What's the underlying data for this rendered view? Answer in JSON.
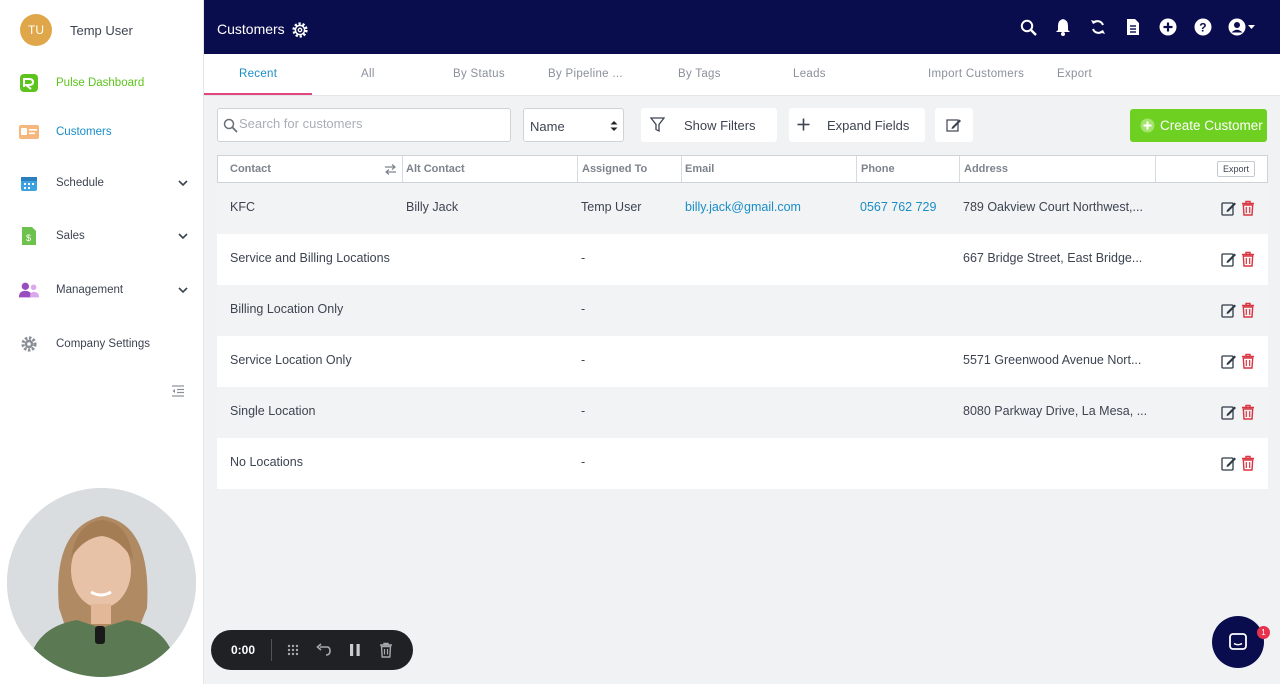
{
  "user": {
    "initials": "TU",
    "name": "Temp User"
  },
  "sidebar": {
    "items": [
      {
        "label": "Pulse Dashboard",
        "color": "#5cc41c"
      },
      {
        "label": "Customers",
        "color": "#1a8dc5"
      },
      {
        "label": "Schedule",
        "color": "#3d4451"
      },
      {
        "label": "Sales",
        "color": "#3d4451"
      },
      {
        "label": "Management",
        "color": "#3d4451"
      },
      {
        "label": "Company Settings",
        "color": "#3d4451"
      }
    ]
  },
  "recorder": {
    "time": "0:00"
  },
  "header": {
    "title": "Customers"
  },
  "tabs": [
    {
      "label": "Recent"
    },
    {
      "label": "All"
    },
    {
      "label": "By Status"
    },
    {
      "label": "By Pipeline ..."
    },
    {
      "label": "By Tags"
    },
    {
      "label": "Leads"
    },
    {
      "label": "Import Customers"
    },
    {
      "label": "Export"
    }
  ],
  "toolbar": {
    "search_placeholder": "Search for customers",
    "sort_value": "Name",
    "show_filters": "Show Filters",
    "expand_fields": "Expand Fields",
    "create_customer": "Create Customer"
  },
  "table": {
    "columns": [
      "Contact",
      "Alt Contact",
      "Assigned To",
      "Email",
      "Phone",
      "Address"
    ],
    "export_label": "Export",
    "rows": [
      {
        "contact": "KFC",
        "alt": "Billy Jack",
        "assigned": "Temp User",
        "email": "billy.jack@gmail.com",
        "phone": "0567 762 729",
        "address": "789 Oakview Court Northwest,..."
      },
      {
        "contact": "Service and Billing Locations",
        "alt": "",
        "assigned": "-",
        "email": "",
        "phone": "",
        "address": "667 Bridge Street, East Bridge..."
      },
      {
        "contact": "Billing Location Only",
        "alt": "",
        "assigned": "-",
        "email": "",
        "phone": "",
        "address": ""
      },
      {
        "contact": "Service Location Only",
        "alt": "",
        "assigned": "-",
        "email": "",
        "phone": "",
        "address": "5571 Greenwood Avenue Nort..."
      },
      {
        "contact": "Single Location",
        "alt": "",
        "assigned": "-",
        "email": "",
        "phone": "",
        "address": "8080 Parkway Drive, La Mesa, ..."
      },
      {
        "contact": "No Locations",
        "alt": "",
        "assigned": "-",
        "email": "",
        "phone": "",
        "address": ""
      }
    ]
  },
  "chat": {
    "badge": "1"
  },
  "colors": {
    "navy": "#0a0d4d",
    "green": "#6ed021",
    "link": "#1a8dc5",
    "tab_underline": "#e0457b",
    "delete": "#d9343f"
  }
}
